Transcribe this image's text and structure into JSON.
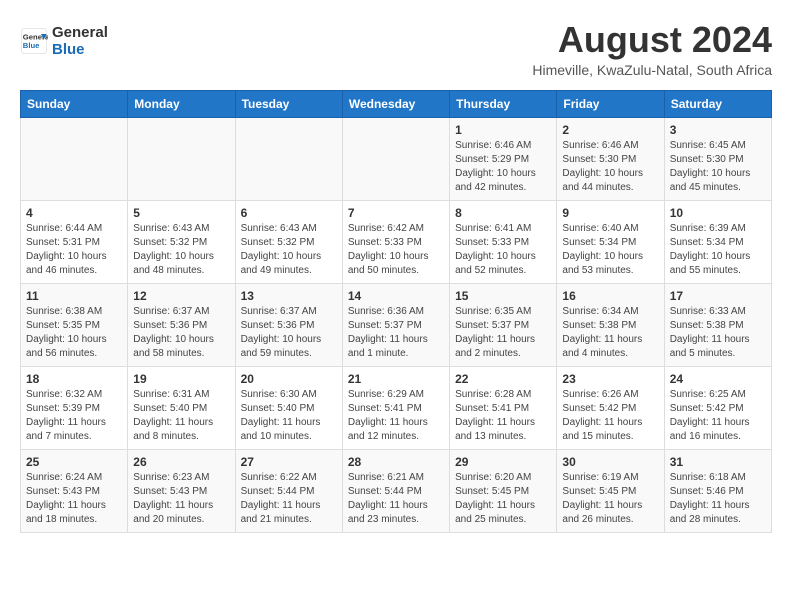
{
  "logo": {
    "line1": "General",
    "line2": "Blue"
  },
  "title": "August 2024",
  "location": "Himeville, KwaZulu-Natal, South Africa",
  "days_of_week": [
    "Sunday",
    "Monday",
    "Tuesday",
    "Wednesday",
    "Thursday",
    "Friday",
    "Saturday"
  ],
  "weeks": [
    [
      {
        "day": "",
        "info": ""
      },
      {
        "day": "",
        "info": ""
      },
      {
        "day": "",
        "info": ""
      },
      {
        "day": "",
        "info": ""
      },
      {
        "day": "1",
        "info": "Sunrise: 6:46 AM\nSunset: 5:29 PM\nDaylight: 10 hours\nand 42 minutes."
      },
      {
        "day": "2",
        "info": "Sunrise: 6:46 AM\nSunset: 5:30 PM\nDaylight: 10 hours\nand 44 minutes."
      },
      {
        "day": "3",
        "info": "Sunrise: 6:45 AM\nSunset: 5:30 PM\nDaylight: 10 hours\nand 45 minutes."
      }
    ],
    [
      {
        "day": "4",
        "info": "Sunrise: 6:44 AM\nSunset: 5:31 PM\nDaylight: 10 hours\nand 46 minutes."
      },
      {
        "day": "5",
        "info": "Sunrise: 6:43 AM\nSunset: 5:32 PM\nDaylight: 10 hours\nand 48 minutes."
      },
      {
        "day": "6",
        "info": "Sunrise: 6:43 AM\nSunset: 5:32 PM\nDaylight: 10 hours\nand 49 minutes."
      },
      {
        "day": "7",
        "info": "Sunrise: 6:42 AM\nSunset: 5:33 PM\nDaylight: 10 hours\nand 50 minutes."
      },
      {
        "day": "8",
        "info": "Sunrise: 6:41 AM\nSunset: 5:33 PM\nDaylight: 10 hours\nand 52 minutes."
      },
      {
        "day": "9",
        "info": "Sunrise: 6:40 AM\nSunset: 5:34 PM\nDaylight: 10 hours\nand 53 minutes."
      },
      {
        "day": "10",
        "info": "Sunrise: 6:39 AM\nSunset: 5:34 PM\nDaylight: 10 hours\nand 55 minutes."
      }
    ],
    [
      {
        "day": "11",
        "info": "Sunrise: 6:38 AM\nSunset: 5:35 PM\nDaylight: 10 hours\nand 56 minutes."
      },
      {
        "day": "12",
        "info": "Sunrise: 6:37 AM\nSunset: 5:36 PM\nDaylight: 10 hours\nand 58 minutes."
      },
      {
        "day": "13",
        "info": "Sunrise: 6:37 AM\nSunset: 5:36 PM\nDaylight: 10 hours\nand 59 minutes."
      },
      {
        "day": "14",
        "info": "Sunrise: 6:36 AM\nSunset: 5:37 PM\nDaylight: 11 hours\nand 1 minute."
      },
      {
        "day": "15",
        "info": "Sunrise: 6:35 AM\nSunset: 5:37 PM\nDaylight: 11 hours\nand 2 minutes."
      },
      {
        "day": "16",
        "info": "Sunrise: 6:34 AM\nSunset: 5:38 PM\nDaylight: 11 hours\nand 4 minutes."
      },
      {
        "day": "17",
        "info": "Sunrise: 6:33 AM\nSunset: 5:38 PM\nDaylight: 11 hours\nand 5 minutes."
      }
    ],
    [
      {
        "day": "18",
        "info": "Sunrise: 6:32 AM\nSunset: 5:39 PM\nDaylight: 11 hours\nand 7 minutes."
      },
      {
        "day": "19",
        "info": "Sunrise: 6:31 AM\nSunset: 5:40 PM\nDaylight: 11 hours\nand 8 minutes."
      },
      {
        "day": "20",
        "info": "Sunrise: 6:30 AM\nSunset: 5:40 PM\nDaylight: 11 hours\nand 10 minutes."
      },
      {
        "day": "21",
        "info": "Sunrise: 6:29 AM\nSunset: 5:41 PM\nDaylight: 11 hours\nand 12 minutes."
      },
      {
        "day": "22",
        "info": "Sunrise: 6:28 AM\nSunset: 5:41 PM\nDaylight: 11 hours\nand 13 minutes."
      },
      {
        "day": "23",
        "info": "Sunrise: 6:26 AM\nSunset: 5:42 PM\nDaylight: 11 hours\nand 15 minutes."
      },
      {
        "day": "24",
        "info": "Sunrise: 6:25 AM\nSunset: 5:42 PM\nDaylight: 11 hours\nand 16 minutes."
      }
    ],
    [
      {
        "day": "25",
        "info": "Sunrise: 6:24 AM\nSunset: 5:43 PM\nDaylight: 11 hours\nand 18 minutes."
      },
      {
        "day": "26",
        "info": "Sunrise: 6:23 AM\nSunset: 5:43 PM\nDaylight: 11 hours\nand 20 minutes."
      },
      {
        "day": "27",
        "info": "Sunrise: 6:22 AM\nSunset: 5:44 PM\nDaylight: 11 hours\nand 21 minutes."
      },
      {
        "day": "28",
        "info": "Sunrise: 6:21 AM\nSunset: 5:44 PM\nDaylight: 11 hours\nand 23 minutes."
      },
      {
        "day": "29",
        "info": "Sunrise: 6:20 AM\nSunset: 5:45 PM\nDaylight: 11 hours\nand 25 minutes."
      },
      {
        "day": "30",
        "info": "Sunrise: 6:19 AM\nSunset: 5:45 PM\nDaylight: 11 hours\nand 26 minutes."
      },
      {
        "day": "31",
        "info": "Sunrise: 6:18 AM\nSunset: 5:46 PM\nDaylight: 11 hours\nand 28 minutes."
      }
    ]
  ]
}
